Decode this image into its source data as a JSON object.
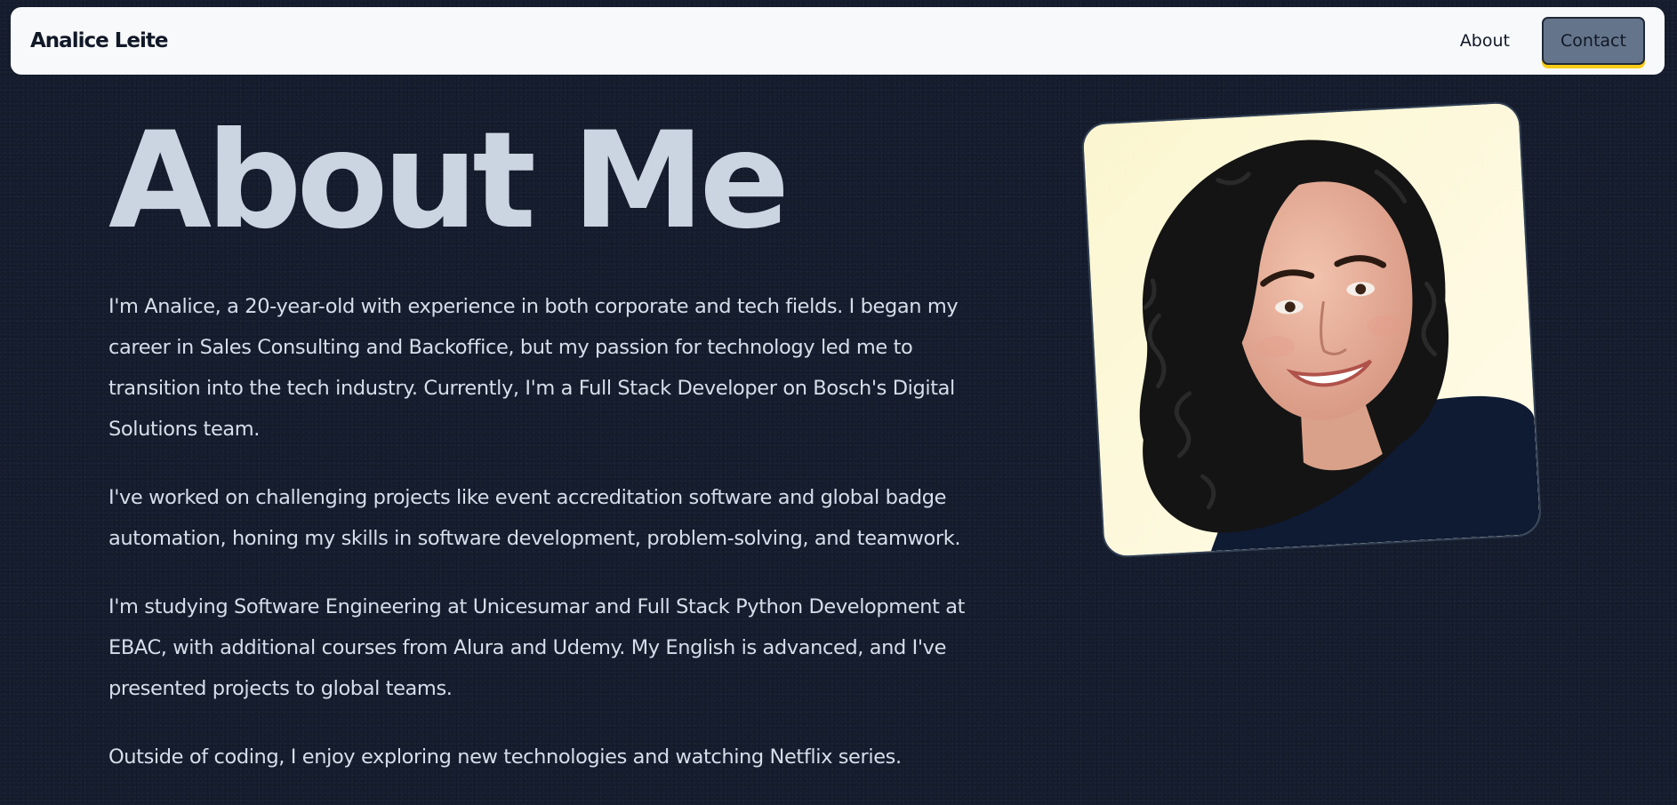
{
  "nav": {
    "brand": "Analice Leite",
    "about_label": "About",
    "contact_label": "Contact"
  },
  "about": {
    "title": "About Me",
    "paragraphs": [
      "I'm Analice, a 20-year-old with experience in both corporate and tech fields. I began my career in Sales Consulting and Backoffice, but my passion for technology led me to transition into the tech industry. Currently, I'm a Full Stack Developer on Bosch's Digital Solutions team.",
      "I've worked on challenging projects like event accreditation software and global badge automation, honing my skills in software development, problem-solving, and teamwork.",
      "I'm studying Software Engineering at Unicesumar and Full Stack Python Development at EBAC, with additional courses from Alura and Udemy. My English is advanced, and I've presented projects to global teams.",
      "Outside of coding, I enjoy exploring new technologies and watching Netflix series."
    ]
  },
  "colors": {
    "background": "#151d2e",
    "navbar": "#f8f9fb",
    "title": "#cbd5e1",
    "body_text": "#d6deea",
    "contact_button": "#64748b",
    "contact_accent": "#facc15"
  }
}
